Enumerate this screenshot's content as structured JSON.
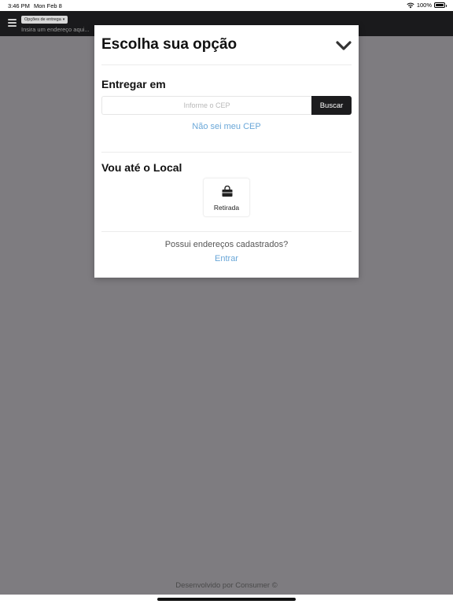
{
  "status_bar": {
    "time": "3:46 PM",
    "date": "Mon Feb 8",
    "battery": "100%"
  },
  "header": {
    "delivery_pill": "Opções de entrega",
    "address_hint": "Insira um endereço aqui..."
  },
  "modal": {
    "title": "Escolha sua opção",
    "delivery_section": {
      "title": "Entregar em",
      "cep_placeholder": "Informe o CEP",
      "cep_value": "",
      "search_button": "Buscar",
      "unknown_cep_link": "Não sei meu CEP"
    },
    "pickup_section": {
      "title": "Vou até o Local",
      "option_label": "Retirada",
      "option_icon": "shopping-bag-icon"
    },
    "login_prompt": {
      "question": "Possui endereços cadastrados?",
      "link": "Entrar"
    }
  },
  "footer": {
    "credit": "Desenvolvido por Consumer ©"
  },
  "colors": {
    "overlay": "#7e7c80",
    "header_bg": "#1a1a1c",
    "button_bg": "#1c1c1e",
    "link": "#6aa7d8"
  }
}
